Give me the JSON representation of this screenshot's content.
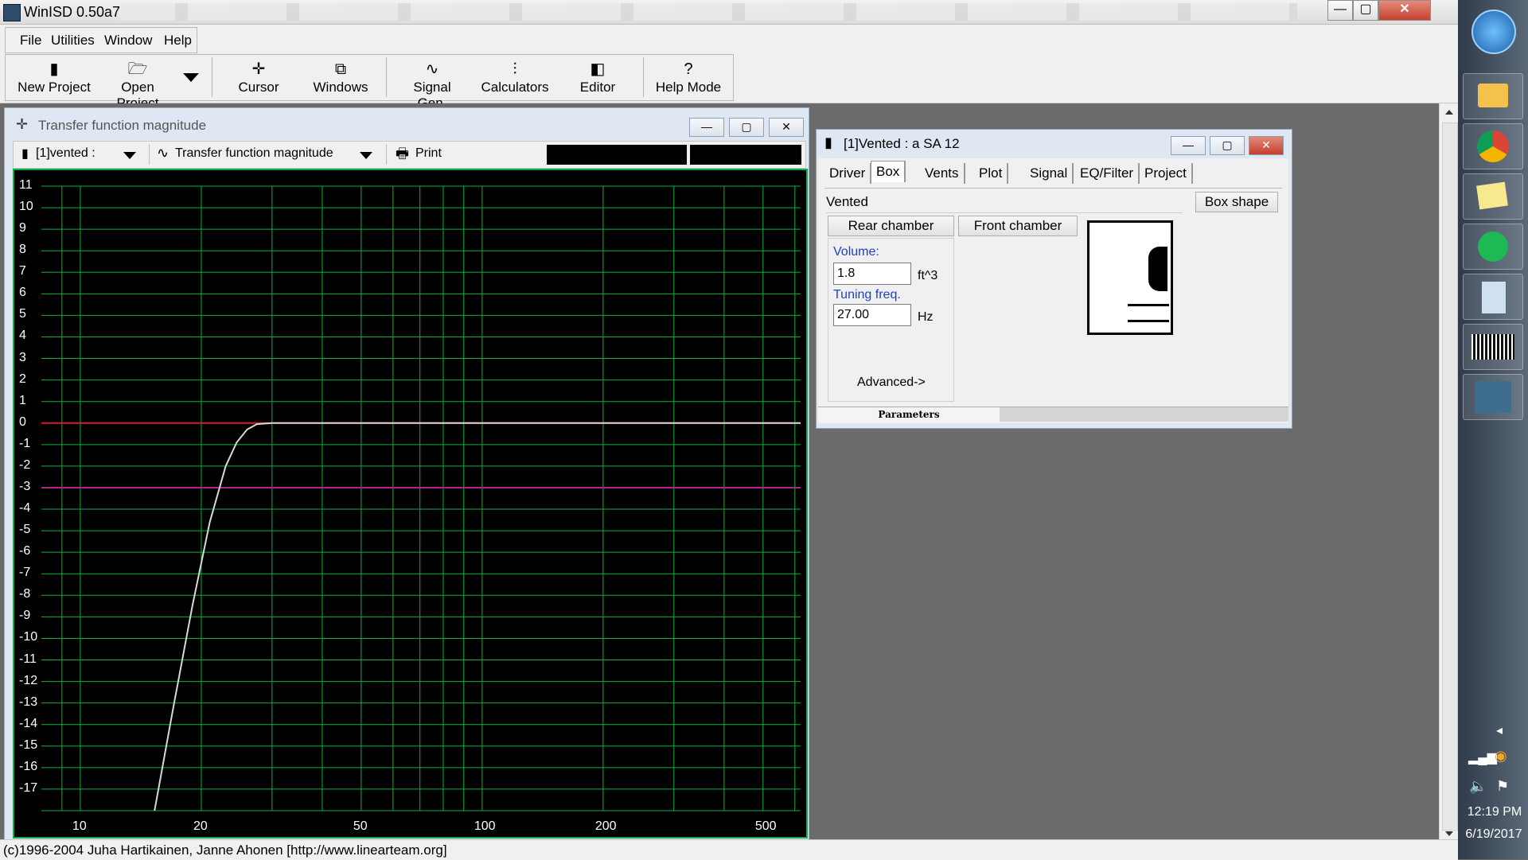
{
  "app": {
    "title": "WinISD 0.50a7",
    "controls": {
      "minimize": "—",
      "maximize": "▢",
      "close": "✕"
    }
  },
  "menu": [
    {
      "label": "File"
    },
    {
      "label": "Utilities"
    },
    {
      "label": "Window"
    },
    {
      "label": "Help"
    }
  ],
  "toolbar": {
    "new_project": "New Project",
    "open_project": "Open Project",
    "cursor": "Cursor",
    "windows": "Windows",
    "signal_gen": "Signal Gen.",
    "calculators": "Calculators",
    "editor": "Editor",
    "help_mode": "Help Mode"
  },
  "plot_window": {
    "title": "Transfer function magnitude",
    "project_select": "[1]vented :",
    "graph_select": "Transfer function magnitude",
    "print": "Print"
  },
  "chart_data": {
    "type": "line",
    "title": "",
    "xlabel": "",
    "ylabel": "",
    "xscale": "log",
    "xlim": [
      8,
      620
    ],
    "ylim": [
      -18,
      11
    ],
    "x_ticks": [
      "10",
      "20",
      "50",
      "100",
      "200",
      "500"
    ],
    "y_ticks": [
      "11",
      "10",
      "9",
      "8",
      "7",
      "6",
      "5",
      "4",
      "3",
      "2",
      "1",
      "0",
      "-1",
      "-2",
      "-3",
      "-4",
      "-5",
      "-6",
      "-7",
      "-8",
      "-9",
      "-10",
      "-11",
      "-12",
      "-13",
      "-14",
      "-15",
      "-16",
      "-17"
    ],
    "reference_lines": [
      {
        "y": 0,
        "color": "#cc2222"
      },
      {
        "y": -3,
        "color": "#aa2a88"
      }
    ],
    "series": [
      {
        "color": "#d8d8d8",
        "x": [
          15.3,
          17,
          19,
          21,
          23,
          24.5,
          26,
          27.5,
          30,
          35,
          50,
          100,
          200,
          620
        ],
        "y": [
          -18,
          -13.3,
          -8.5,
          -4.6,
          -2,
          -0.9,
          -0.3,
          -0.05,
          0,
          0,
          0,
          0,
          0,
          0
        ]
      }
    ],
    "grid": true,
    "background": "#000000",
    "grid_color": "#10b03a"
  },
  "vent_window": {
    "title": "[1]Vented : a SA 12",
    "tabs": [
      "Driver",
      "Box",
      "Vents",
      "Plot",
      "Signal",
      "EQ/Filter",
      "Project"
    ],
    "active_tab": "Box",
    "box_type": "Vented",
    "box_shape_btn": "Box shape",
    "rear_chamber": "Rear chamber",
    "front_chamber": "Front chamber",
    "volume_label": "Volume:",
    "volume_value": "1.8",
    "volume_unit": "ft^3",
    "tuning_label": "Tuning freq.",
    "tuning_value": "27.00",
    "tuning_unit": "Hz",
    "advanced": "Advanced->",
    "footer_tab": "Parameters"
  },
  "statusbar": {
    "text": "(c)1996-2004 Juha Hartikainen, Janne Ahonen [http://www.linearteam.org]"
  },
  "taskbar": {
    "time": "12:19 PM",
    "date": "6/19/2017",
    "apps": [
      "file-explorer-icon",
      "chrome-icon",
      "sticky-notes-icon",
      "spotify-icon",
      "calculator-icon",
      "audio-waveform-icon",
      "winisd-icon"
    ]
  }
}
